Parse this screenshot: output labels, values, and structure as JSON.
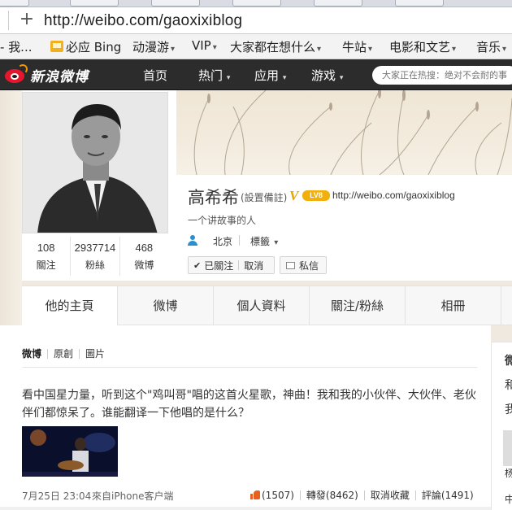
{
  "browser": {
    "url": "http://weibo.com/gaoxixiblog",
    "new_tab_symbol": "+"
  },
  "bookmarks": [
    {
      "label": "- 我..."
    },
    {
      "label": "必应 Bing",
      "icon": "bing-icon"
    },
    {
      "label": "动漫游"
    },
    {
      "label": "VIP"
    },
    {
      "label": "大家都在想什么"
    },
    {
      "label": "牛站"
    },
    {
      "label": "电影和文艺"
    },
    {
      "label": "音乐"
    }
  ],
  "nav": {
    "logo_text": "新浪微博",
    "items": [
      "首页",
      "热门",
      "应用",
      "游戏"
    ],
    "search_placeholder": "大家正在热搜：绝对不会耐的事"
  },
  "profile": {
    "name": "高希希",
    "remark": "(設置備註)",
    "verified": "V",
    "level": "LV8",
    "url": "http://weibo.com/gaoxixiblog",
    "bio": "一个讲故事的人",
    "location": "北京",
    "tags_label": "標籤",
    "followed_label": "已關注",
    "cancel_label": "取消",
    "message_label": "私信",
    "stats": [
      {
        "num": "108",
        "label": "關注"
      },
      {
        "num": "2937714",
        "label": "粉絲"
      },
      {
        "num": "468",
        "label": "微博"
      }
    ]
  },
  "tabs": [
    "他的主頁",
    "微博",
    "個人資料",
    "關注/粉絲",
    "相冊"
  ],
  "feed": {
    "filters": [
      "微博",
      "原創",
      "圖片"
    ],
    "post": {
      "text": "看中国星力量，听到这个\"鸡叫哥\"唱的这首火星歌，神曲！我和我的小伙伴、大伙伴、老伙伴们都惊呆了。谁能翻译一下他唱的是什么？",
      "time": "7月25日 23:04",
      "source": "來自iPhone客户端",
      "likes": "(1507)",
      "repost": "轉發(8462)",
      "unfav": "取消收藏",
      "comment": "評論(1491)"
    }
  },
  "right_panel": {
    "t1": "微",
    "t2": "和",
    "t3": "我",
    "t4": "杨",
    "t5": "中"
  }
}
